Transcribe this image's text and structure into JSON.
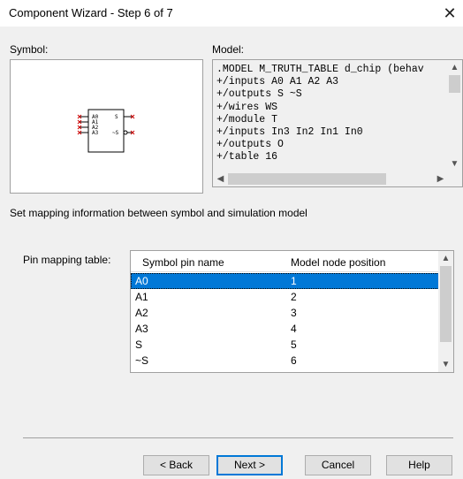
{
  "window": {
    "title": "Component Wizard - Step 6 of 7",
    "close_glyph": "✕"
  },
  "symbol": {
    "label": "Symbol:",
    "pins_left": [
      "A0",
      "A1",
      "A2",
      "A3"
    ],
    "pins_right": [
      "S",
      "~S"
    ]
  },
  "model": {
    "label": "Model:",
    "text": ".MODEL M_TRUTH_TABLE d_chip (behav\n+/inputs A0 A1 A2 A3\n+/outputs S ~S\n+/wires WS\n+/module T\n+/inputs In3 In2 In1 In0\n+/outputs O\n+/table 16"
  },
  "instruction": "Set mapping information between symbol and simulation model",
  "pin_mapping": {
    "label": "Pin mapping table:",
    "columns": [
      "Symbol pin name",
      "Model node position"
    ],
    "rows": [
      [
        "A0",
        "1"
      ],
      [
        "A1",
        "2"
      ],
      [
        "A2",
        "3"
      ],
      [
        "A3",
        "4"
      ],
      [
        "S",
        "5"
      ],
      [
        "~S",
        "6"
      ]
    ],
    "selected_index": 0
  },
  "buttons": {
    "back": "< Back",
    "next": "Next >",
    "cancel": "Cancel",
    "help": "Help"
  },
  "colors": {
    "selection": "#0078d7",
    "pin_marker": "#cc0000"
  }
}
